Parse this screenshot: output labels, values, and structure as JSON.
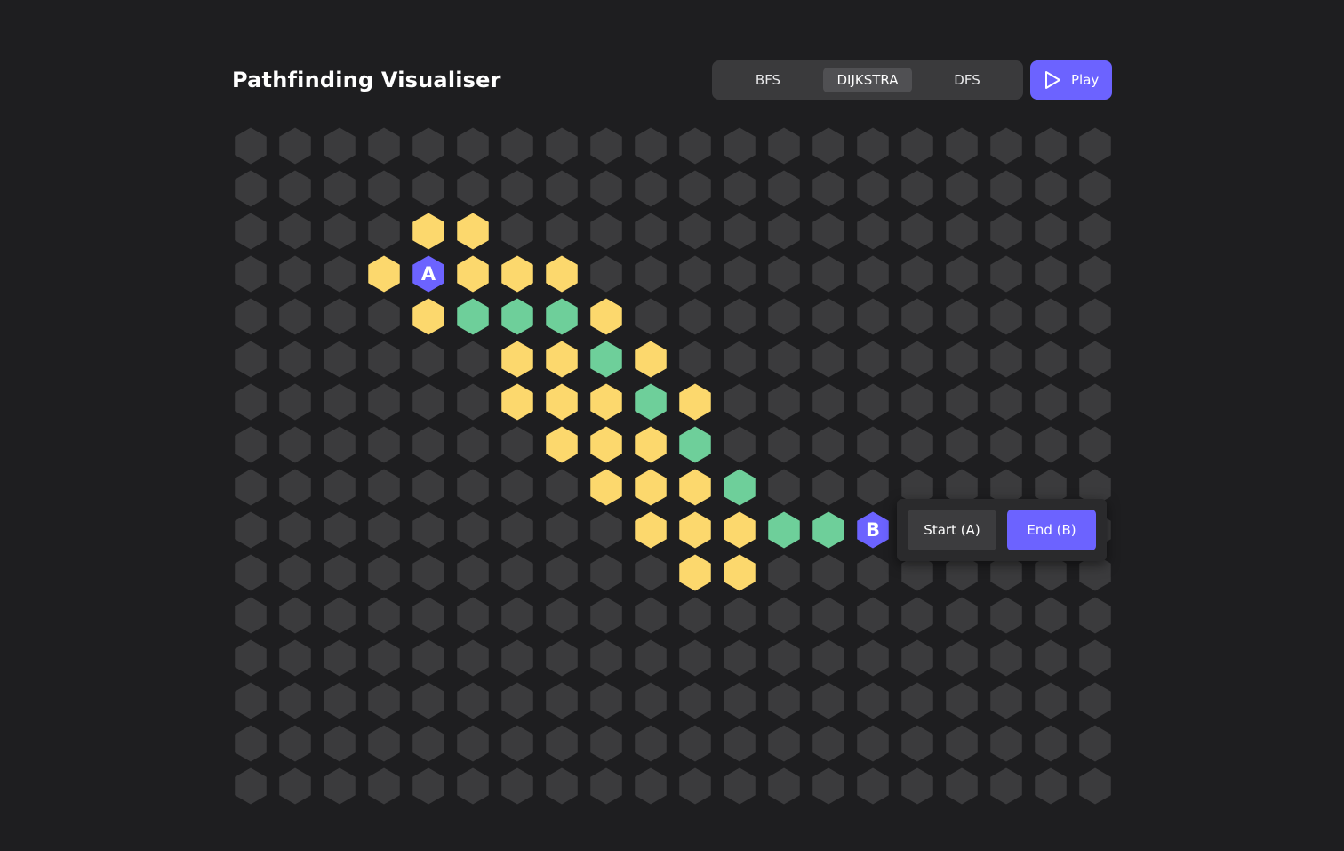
{
  "header": {
    "title": "Pathfinding Visualiser"
  },
  "algorithms": {
    "options": [
      "BFS",
      "DIJKSTRA",
      "DFS"
    ],
    "selected": "DIJKSTRA"
  },
  "play": {
    "label": "Play",
    "icon": "play-icon"
  },
  "colors": {
    "background": "#1e1e20",
    "cell_empty": "#3b3b3d",
    "visited": "#fcd86d",
    "path": "#6ecf9a",
    "endpoint": "#6c63ff",
    "accent": "#6c63ff"
  },
  "grid": {
    "cols": 20,
    "rows": 16,
    "visited": [
      [
        4,
        2
      ],
      [
        5,
        2
      ],
      [
        3,
        3
      ],
      [
        5,
        3
      ],
      [
        6,
        3
      ],
      [
        7,
        3
      ],
      [
        4,
        4
      ],
      [
        8,
        4
      ],
      [
        6,
        5
      ],
      [
        7,
        5
      ],
      [
        9,
        5
      ],
      [
        6,
        6
      ],
      [
        7,
        6
      ],
      [
        8,
        6
      ],
      [
        10,
        6
      ],
      [
        7,
        7
      ],
      [
        8,
        7
      ],
      [
        9,
        7
      ],
      [
        8,
        8
      ],
      [
        9,
        8
      ],
      [
        10,
        8
      ],
      [
        9,
        9
      ],
      [
        10,
        9
      ],
      [
        11,
        9
      ],
      [
        10,
        10
      ],
      [
        11,
        10
      ]
    ],
    "path": [
      [
        5,
        4
      ],
      [
        6,
        4
      ],
      [
        7,
        4
      ],
      [
        8,
        5
      ],
      [
        9,
        6
      ],
      [
        10,
        7
      ],
      [
        11,
        8
      ],
      [
        12,
        9
      ],
      [
        13,
        9
      ]
    ],
    "start": {
      "col": 4,
      "row": 3,
      "label": "A"
    },
    "end": {
      "col": 14,
      "row": 9,
      "label": "B"
    }
  },
  "popover": {
    "start_label": "Start (A)",
    "end_label": "End (B)",
    "selected": "end"
  }
}
